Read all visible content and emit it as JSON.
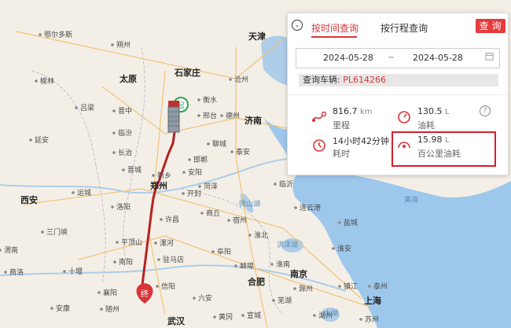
{
  "map": {
    "cities_major": [
      "天津",
      "石家庄",
      "太原",
      "济南",
      "郑州",
      "西安",
      "武汉",
      "合肥",
      "南京",
      "上海"
    ],
    "cities": [
      "鄂尔多斯",
      "朔州",
      "榆林",
      "沧州",
      "衡水",
      "吕梁",
      "晋中",
      "邢台",
      "德州",
      "临汾",
      "长治",
      "邯郸",
      "聊城",
      "泰安",
      "延安",
      "晋城",
      "安阳",
      "运城",
      "新乡",
      "菏泽",
      "临沂",
      "开封",
      "许昌",
      "洛阳",
      "商丘",
      "连云港",
      "三门峡",
      "宿州",
      "渭南",
      "平顶山",
      "漯河",
      "淮北",
      "阜阳",
      "淮安",
      "盐城",
      "南阳",
      "驻马店",
      "商洛",
      "十堰",
      "信阳",
      "蚌埠",
      "淮南",
      "襄阳",
      "滁州",
      "六安",
      "镇江",
      "泰州",
      "安康",
      "随州",
      "芜湖",
      "黄冈",
      "湖州",
      "苏州",
      "宣城"
    ],
    "water": [
      "黄海",
      "微山湖",
      "洪泽湖",
      "太湖"
    ],
    "end_marker": "终",
    "start_marker": "起"
  },
  "panel": {
    "tabs": [
      "按时间查询",
      "按行程查询"
    ],
    "query_button": "查询",
    "date_start": "2024-05-28",
    "date_sep": "~",
    "date_end": "2024-05-28",
    "vehicle_label": "查询车辆:",
    "vehicle_plate": "PL614266",
    "stats": {
      "mileage": {
        "value": "816.7",
        "unit": "km",
        "label": "里程"
      },
      "fuel": {
        "value": "130.5",
        "unit": "L",
        "label": "油耗"
      },
      "duration": {
        "value": "14小时42分钟",
        "unit": "",
        "label": "耗时"
      },
      "fuel_per_100km": {
        "value": "15.98",
        "unit": "L",
        "label": "百公里油耗"
      }
    },
    "help": "?"
  },
  "colors": {
    "accent": "#d9353b",
    "route": "#b52124"
  }
}
